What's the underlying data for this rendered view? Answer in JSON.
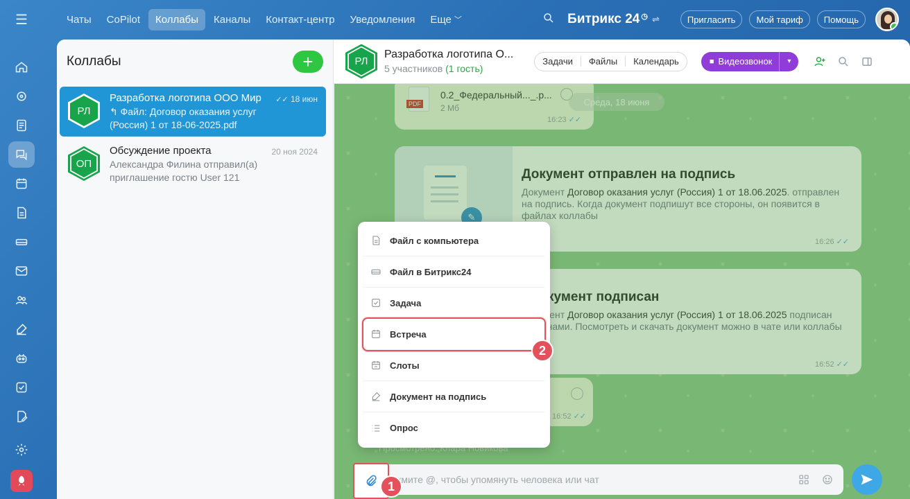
{
  "topnav": {
    "tabs": [
      "Чаты",
      "CoPilot",
      "Коллабы",
      "Каналы",
      "Контакт-центр",
      "Уведомления"
    ],
    "active_tab": "Коллабы",
    "more_label": "Еще",
    "brand": "Битрикс 24",
    "invite_label": "Пригласить",
    "tariff_label": "Мой тариф",
    "help_label": "Помощь"
  },
  "rail": {
    "icons": [
      "menu-icon",
      "home-icon",
      "copilot-icon",
      "feed-icon",
      "chats-icon",
      "calendar-icon",
      "docs-icon",
      "drive-icon",
      "mail-icon",
      "groups-icon",
      "sign-icon",
      "bot-icon",
      "tasks-icon",
      "edit-icon",
      "settings-icon",
      "rocket-icon"
    ]
  },
  "sidebar": {
    "title": "Коллабы",
    "chats": [
      {
        "avatar": "РЛ",
        "name": "Разработка логотипа ООО Мир",
        "date": "18 июн",
        "preview_line1": "↰ Файл: Договор оказания услуг",
        "preview_line2": "(Россия) 1 от 18-06-2025.pdf"
      },
      {
        "avatar": "ОП",
        "name": "Обсуждение проекта",
        "date": "20 ноя 2024",
        "preview_line1": "Александра Филина отправил(а)",
        "preview_line2": "приглашение гостю User 121"
      }
    ]
  },
  "chat": {
    "avatar": "РЛ",
    "title": "Разработка логотипа О...",
    "members": "5 участников",
    "guest": "(1 гость)",
    "segments": [
      "Задачи",
      "Файлы",
      "Календарь"
    ],
    "video_label": "Видеозвонок"
  },
  "messages": {
    "file_name": "0.2_Федеральный..._.p...",
    "file_size": "2 Мб",
    "file_badge": "PDF",
    "file_time": "16:23",
    "date_chip": "Среда, 18 июня",
    "doc_sent_title": "Документ отправлен на подпись",
    "doc_sent_text_a": "Документ ",
    "doc_sent_doc": "Договор оказания услуг (Россия) 1 от 18.06.2025",
    "doc_sent_text_b": ". отправлен на подпись. Когда документ подпишут все стороны, он появится в файлах коллабы",
    "doc_sent_time": "16:26",
    "doc_signed_title": "кумент подписан",
    "doc_signed_text_a": "Документ ",
    "doc_signed_doc": "Договор оказания услуг (Россия) 1 от 18.06.2025",
    "doc_signed_text_b": " подписан сторонами. Посмотреть и скачать документ можно в чате или коллабы",
    "doc_signed_time": "16:52",
    "small_time": "16:52",
    "seen": "Просмотрено: Клара Новикова"
  },
  "input": {
    "placeholder": "жмите @, чтобы упомянуть человека или чат"
  },
  "menu": {
    "items": [
      {
        "label": "Файл с компьютера",
        "icon": "file-icon"
      },
      {
        "label": "Файл в Битрикс24",
        "icon": "drive-icon"
      },
      {
        "label": "Задача",
        "icon": "task-icon"
      },
      {
        "label": "Встреча",
        "icon": "meeting-icon"
      },
      {
        "label": "Слоты",
        "icon": "slots-icon"
      },
      {
        "label": "Документ на подпись",
        "icon": "sign-icon"
      },
      {
        "label": "Опрос",
        "icon": "poll-icon"
      }
    ],
    "highlighted": "Встреча"
  },
  "markers": [
    "1",
    "2"
  ],
  "colors": {
    "accent_blue": "#2196d6",
    "collab_green": "#18a44a",
    "marker_red": "#e2515c",
    "video_purple": "#8f3cd8"
  }
}
